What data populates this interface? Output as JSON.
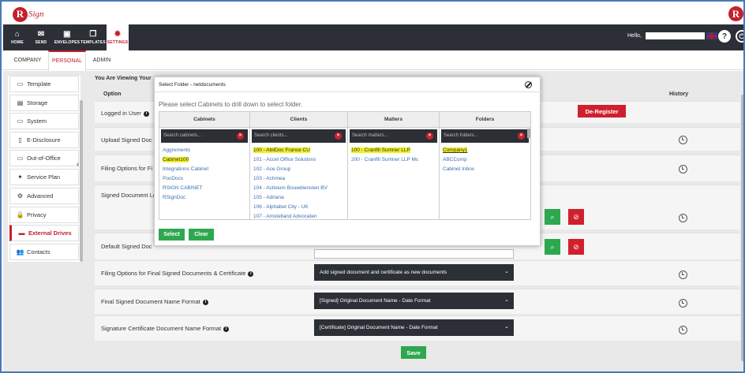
{
  "app": {
    "logo_letter": "R",
    "logo_text": "Sign"
  },
  "nav": {
    "items": [
      {
        "label": "HOME",
        "icon": "home-icon"
      },
      {
        "label": "SEND",
        "icon": "envelope-icon"
      },
      {
        "label": "ENVELOPES",
        "icon": "envelopes-icon"
      },
      {
        "label": "TEMPLATES",
        "icon": "templates-icon"
      },
      {
        "label": "SETTINGS",
        "icon": "gear-icon"
      }
    ],
    "hello": "Hello,",
    "help": "?",
    "power": "⏻"
  },
  "tabs": [
    "COMPANY",
    "PERSONAL",
    "ADMIN"
  ],
  "sidebar": {
    "items": [
      {
        "label": "Template",
        "icon": "template-icon",
        "glyph": "▭"
      },
      {
        "label": "Storage",
        "icon": "storage-icon",
        "glyph": "▤"
      },
      {
        "label": "System",
        "icon": "monitor-icon",
        "glyph": "▭"
      },
      {
        "label": "E-Disclosure",
        "icon": "document-icon",
        "glyph": "▯"
      },
      {
        "label": "Out-of-Office",
        "icon": "calendar-icon",
        "glyph": "▭"
      },
      {
        "label": "Service Plan",
        "icon": "plan-icon",
        "glyph": "✦"
      },
      {
        "label": "Advanced",
        "icon": "cogs-icon",
        "glyph": "⚙"
      },
      {
        "label": "Privacy",
        "icon": "lock-icon",
        "glyph": "🔒"
      },
      {
        "label": "External Drives",
        "icon": "drive-icon",
        "glyph": "▬"
      },
      {
        "label": "Contacts",
        "icon": "contacts-icon",
        "glyph": "👥"
      }
    ]
  },
  "main": {
    "viewing": "You Are Viewing Your",
    "col_option": "Option",
    "col_history": "History",
    "rows": {
      "logged_in": "Logged in User",
      "deregister": "De-Register",
      "upload_signed": "Upload Signed Doc",
      "filing_options": "Filing Options for Fi",
      "signed_doc": "Signed Document Lo",
      "default_signed": "Default Signed Doc",
      "filing_final": "Filing Options for Final Signed Documents & Certificate",
      "filing_final_value": "Add signed document and certificate as new documents",
      "final_name": "Final Signed Document Name Format",
      "final_name_value": "[Signed] Original Document Name - Date Format",
      "cert_name": "Signature Certificate Document Name Format",
      "cert_name_value": "[Certificate] Original Document Name - Date Format"
    },
    "save": "Save"
  },
  "modal": {
    "title": "Select Folder - netdocuments",
    "hint": "Please select Cabinets to drill down to select folder.",
    "select": "Select",
    "clear": "Clear",
    "columns": [
      {
        "header": "Cabinets",
        "search": "Search cabinets...",
        "items": [
          {
            "text": "Aggrements",
            "hl": false
          },
          {
            "text": "Cabinet100",
            "hl": true
          },
          {
            "text": "Integrations Cabinet",
            "hl": false
          },
          {
            "text": "PocDocs",
            "hl": false
          },
          {
            "text": "RSIGN CABINET",
            "hl": false
          },
          {
            "text": "RSignDoc",
            "hl": false
          }
        ]
      },
      {
        "header": "Clients",
        "search": "Search clients...",
        "items": [
          {
            "text": "100 - AbilDoc France CU",
            "hl": true
          },
          {
            "text": "101 - Accel Office Solutions",
            "hl": false
          },
          {
            "text": "102 - Ace Group",
            "hl": false
          },
          {
            "text": "103 - Achmea",
            "hl": false
          },
          {
            "text": "104 - Activium Bouwdiensten BV",
            "hl": false
          },
          {
            "text": "105 - Adriana",
            "hl": false
          },
          {
            "text": "106 - Alphabet City - UK",
            "hl": false
          },
          {
            "text": "107 - Amstelland Advocaten",
            "hl": false
          }
        ]
      },
      {
        "header": "Matters",
        "search": "Search matters...",
        "items": [
          {
            "text": "100 - Cranfill Sumner LLP",
            "hl": true
          },
          {
            "text": "200 - Cranfill Sumner LLP Mc",
            "hl": false
          }
        ]
      },
      {
        "header": "Folders",
        "search": "Search folders...",
        "items": [
          {
            "text": "Company1",
            "hl": true,
            "u": true
          },
          {
            "text": "ABCComp",
            "hl": false
          },
          {
            "text": "Cabinet Inbox",
            "hl": false
          }
        ]
      }
    ]
  }
}
